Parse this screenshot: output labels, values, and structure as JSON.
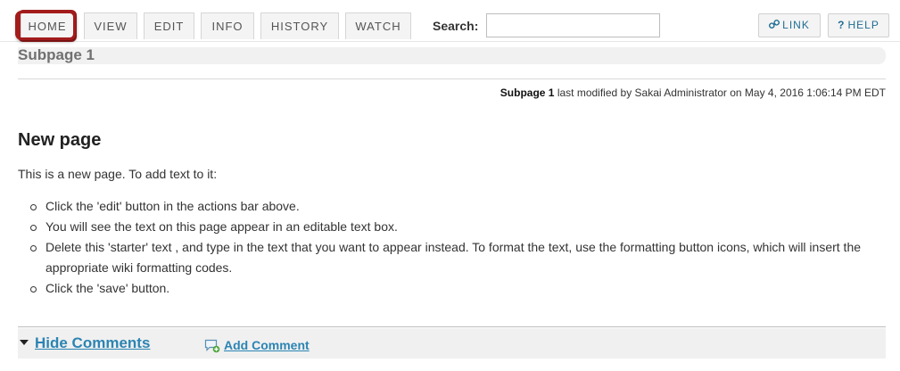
{
  "toolbar": {
    "tabs": [
      {
        "label": "HOME"
      },
      {
        "label": "VIEW"
      },
      {
        "label": "EDIT"
      },
      {
        "label": "INFO"
      },
      {
        "label": "HISTORY"
      },
      {
        "label": "WATCH"
      }
    ],
    "search_label": "Search:",
    "search_value": "",
    "link_label": "LINK",
    "help_label": "HELP",
    "help_icon_glyph": "?"
  },
  "page": {
    "title": "Subpage 1",
    "modified_page": "Subpage 1",
    "modified_text": " last modified by Sakai Administrator on May 4, 2016 1:06:14 PM EDT"
  },
  "content": {
    "heading": "New page",
    "intro": "This is a new page. To add text to it:",
    "bullets": [
      "Click the 'edit' button in the actions bar above.",
      "You will see the text on this page appear in an editable text box.",
      "Delete this 'starter' text , and type in the text that you want to appear instead. To format the text, use the formatting button icons, which will insert the appropriate wiki formatting codes.",
      "Click the 'save' button."
    ]
  },
  "comments": {
    "hide_label": "Hide Comments",
    "add_label": "Add Comment"
  },
  "colors": {
    "highlight_ring": "#a31b1b",
    "link_blue": "#2b84b3",
    "button_text": "#1f6d93"
  }
}
